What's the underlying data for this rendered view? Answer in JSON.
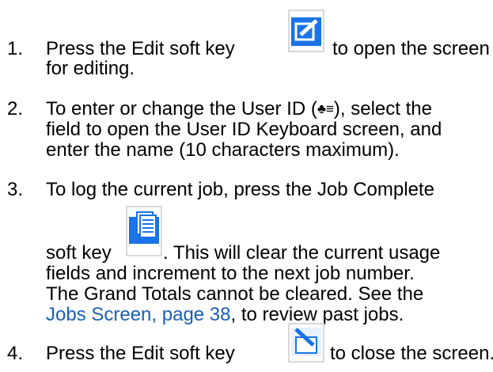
{
  "steps": [
    {
      "number": "1.",
      "text_a": "Press the Edit soft key",
      "text_b": "to open the screen",
      "text_c": "for editing."
    },
    {
      "number": "2.",
      "line1_a": "To enter or change the User ID (",
      "line1_icon": "♣≡",
      "line1_b": "), select the",
      "line2": "field to open the User ID Keyboard screen, and",
      "line3": "enter the name (10 characters maximum)."
    },
    {
      "number": "3.",
      "line1": "To log the current job, press the Job Complete",
      "line2_a": "soft key",
      "line2_b": ". This will clear the current usage",
      "line3": "fields and increment to the next job number.",
      "line4": "The Grand Totals cannot be cleared.  See the",
      "link": "Jobs Screen, page 38",
      "line5_b": ", to review past jobs."
    },
    {
      "number": "4.",
      "text_a": "Press the Edit soft key",
      "text_b": "to close the screen."
    }
  ],
  "icons": {
    "edit_open": "edit-open-key-icon",
    "job_complete": "job-complete-key-icon",
    "edit_close": "edit-close-key-icon",
    "user_id": "user-id-icon"
  },
  "colors": {
    "link": "#1a5fb4",
    "key_blue": "#1a73e8"
  }
}
